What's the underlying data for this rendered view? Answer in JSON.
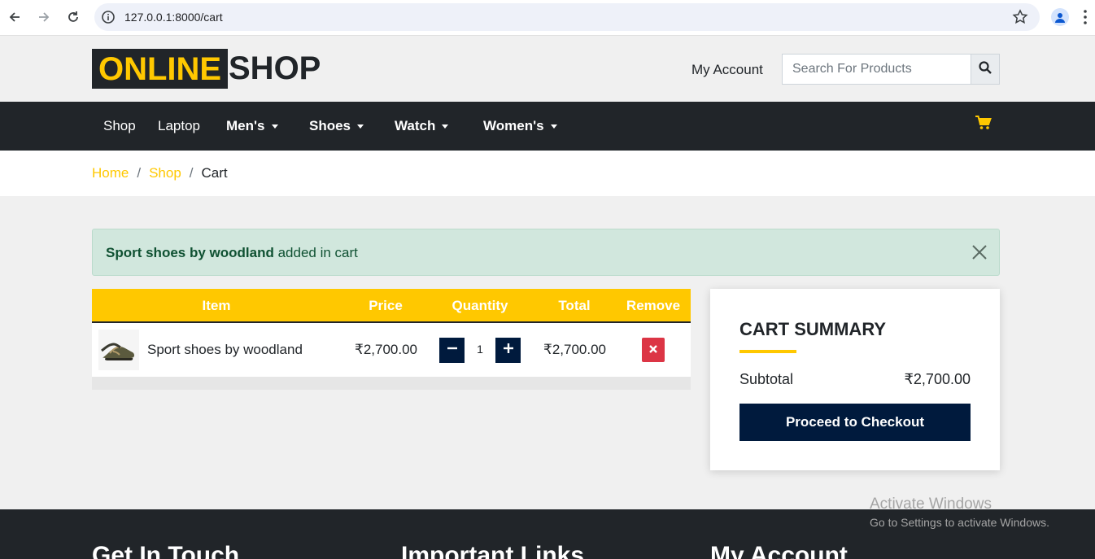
{
  "browser": {
    "url": "127.0.0.1:8000/cart"
  },
  "header": {
    "logo_highlight": "ONLINE",
    "logo_rest": "SHOP",
    "my_account": "My Account",
    "search_placeholder": "Search For Products"
  },
  "nav": {
    "items": [
      {
        "label": "Shop",
        "dropdown": false
      },
      {
        "label": "Laptop",
        "dropdown": false
      },
      {
        "label": "Men's",
        "dropdown": true
      },
      {
        "label": "Shoes",
        "dropdown": true
      },
      {
        "label": "Watch",
        "dropdown": true
      },
      {
        "label": "Women's",
        "dropdown": true
      }
    ]
  },
  "breadcrumb": {
    "home": "Home",
    "shop": "Shop",
    "current": "Cart",
    "separator": "/"
  },
  "alert": {
    "product": "Sport shoes by woodland",
    "message": " added in cart"
  },
  "cart": {
    "headers": {
      "item": "Item",
      "price": "Price",
      "quantity": "Quantity",
      "total": "Total",
      "remove": "Remove"
    },
    "rows": [
      {
        "name": "Sport shoes by woodland",
        "price": "₹2,700.00",
        "quantity": "1",
        "total": "₹2,700.00"
      }
    ]
  },
  "summary": {
    "title": "CART SUMMARY",
    "subtotal_label": "Subtotal",
    "subtotal_value": "₹2,700.00",
    "checkout_label": "Proceed to Checkout"
  },
  "footer": {
    "col1": "Get In Touch",
    "col2": "Important Links",
    "col3": "My Account"
  },
  "watermark": {
    "title": "Activate Windows",
    "subtitle": "Go to Settings to activate Windows."
  },
  "colors": {
    "accent": "#ffc800",
    "dark": "#212529",
    "navy": "#001a3d",
    "danger": "#dc3545",
    "alert_bg": "#d1e7dd"
  }
}
